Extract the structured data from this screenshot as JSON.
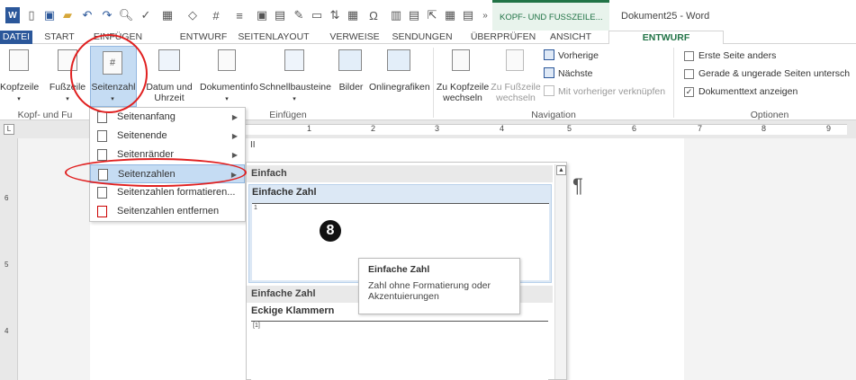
{
  "titlebar": {
    "contextual_tab": "KOPF- UND FUSSZEILE...",
    "doc_title": "Dokument25 - Word"
  },
  "tabs": [
    "DATEI",
    "START",
    "EINFÜGEN",
    "ENTWURF",
    "SEITENLAYOUT",
    "VERWEISE",
    "SENDUNGEN",
    "ÜBERPRÜFEN",
    "ANSICHT",
    "ENTWURF"
  ],
  "ribbon": {
    "kopfzeile": "Kopfzeile",
    "fusszeile": "Fußzeile",
    "seitenzahl": "Seitenzahl",
    "datum_l1": "Datum und",
    "datum_l2": "Uhrzeit",
    "dokumentinfo": "Dokumentinfo",
    "schnellbausteine": "Schnellbausteine",
    "bilder": "Bilder",
    "onlinegrafiken": "Onlinegrafiken",
    "zu_kopfzeile_l1": "Zu Kopfzeile",
    "zu_kopfzeile_l2": "wechseln",
    "zu_fusszeile_l1": "Zu Fußzeile",
    "zu_fusszeile_l2": "wechseln",
    "vorherige": "Vorherige",
    "naechste": "Nächste",
    "verknuepfen": "Mit vorheriger verknüpfen",
    "opt_erste": "Erste Seite anders",
    "opt_gerade": "Gerade & ungerade Seiten untersch",
    "opt_doktext": "Dokumenttext anzeigen",
    "grp_kopf": "Kopf- und Fu",
    "grp_einfuegen": "Einfügen",
    "grp_navigation": "Navigation",
    "grp_optionen": "Optionen"
  },
  "ruler": [
    "1",
    "2",
    "3",
    "4",
    "5",
    "6",
    "7",
    "8",
    "9"
  ],
  "vruler": [
    "6",
    "5",
    "4"
  ],
  "menu": [
    "Seitenanfang",
    "Seitenende",
    "Seitenränder",
    "Seitenzahlen",
    "Seitenzahlen formatieren...",
    "Seitenzahlen entfernen"
  ],
  "gallery": {
    "head": "Einfach",
    "item1": "Einfache Zahl",
    "sample1": "1",
    "sub2": "Einfache Zahl",
    "item2": "Eckige Klammern",
    "sample2": "[1]"
  },
  "tooltip": {
    "title": "Einfache Zahl",
    "desc": "Zahl ohne Formatierung oder Akzentuierungen"
  },
  "annotation": "8",
  "doc": {
    "pilcrow": "¶",
    "marker": "II"
  },
  "colors": {
    "file_tab": "#2b579a",
    "contextual": "#217346",
    "highlight": "#c5dcf3",
    "accent": "#2b579a"
  }
}
